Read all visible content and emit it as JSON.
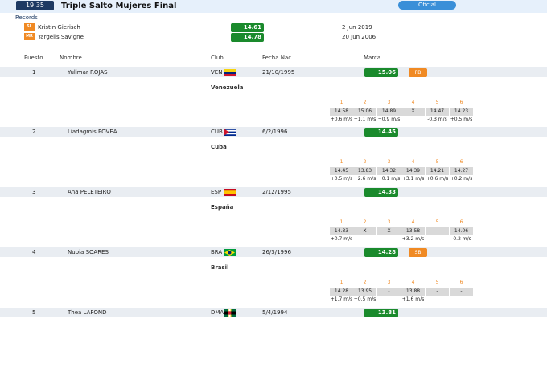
{
  "header": {
    "time": "19:35",
    "title": "Triple Salto Mujeres Final",
    "status": "Oficial"
  },
  "records": {
    "label": "Records",
    "items": [
      {
        "badge": "SL",
        "name": "Kristin Gierisch",
        "mark": "14.61",
        "date": "2 Jun 2019"
      },
      {
        "badge": "MR",
        "name": "Yargelis Savigne",
        "mark": "14.78",
        "date": "20 Jun 2006"
      }
    ]
  },
  "columns": {
    "pos": "Puesto",
    "name": "Nombre",
    "club": "Club",
    "dob": "Fecha Nac.",
    "mark": "Marca"
  },
  "athletes": [
    {
      "pos": "1",
      "name": "Yulimar ROJAS",
      "code": "VEN",
      "dob": "21/10/1995",
      "mark": "15.06",
      "badge": "PB",
      "country": "Venezuela",
      "attempts": [
        {
          "n": "1",
          "v": "14.58",
          "w": "+0.6 m/s"
        },
        {
          "n": "2",
          "v": "15.06",
          "w": "+1.1 m/s"
        },
        {
          "n": "3",
          "v": "14.89",
          "w": "+0.9 m/s"
        },
        {
          "n": "4",
          "v": "X",
          "w": ""
        },
        {
          "n": "5",
          "v": "14.47",
          "w": "-0.3 m/s"
        },
        {
          "n": "6",
          "v": "14.23",
          "w": "+0.5 m/s"
        }
      ]
    },
    {
      "pos": "2",
      "name": "Liadagmis POVEA",
      "code": "CUB",
      "dob": "6/2/1996",
      "mark": "14.45",
      "badge": "",
      "country": "Cuba",
      "attempts": [
        {
          "n": "1",
          "v": "14.45",
          "w": "+0.5 m/s"
        },
        {
          "n": "2",
          "v": "13.83",
          "w": "+2.6 m/s"
        },
        {
          "n": "3",
          "v": "14.32",
          "w": "+0.1 m/s"
        },
        {
          "n": "4",
          "v": "14.39",
          "w": "+3.1 m/s"
        },
        {
          "n": "5",
          "v": "14.21",
          "w": "+0.6 m/s"
        },
        {
          "n": "6",
          "v": "14.27",
          "w": "+0.2 m/s"
        }
      ]
    },
    {
      "pos": "3",
      "name": "Ana PELETEIRO",
      "code": "ESP",
      "dob": "2/12/1995",
      "mark": "14.33",
      "badge": "",
      "country": "España",
      "attempts": [
        {
          "n": "1",
          "v": "14.33",
          "w": "+0.7 m/s"
        },
        {
          "n": "2",
          "v": "X",
          "w": ""
        },
        {
          "n": "3",
          "v": "X",
          "w": ""
        },
        {
          "n": "4",
          "v": "13.58",
          "w": "+3.2 m/s"
        },
        {
          "n": "5",
          "v": "-",
          "w": ""
        },
        {
          "n": "6",
          "v": "14.06",
          "w": "-0.2 m/s"
        }
      ]
    },
    {
      "pos": "4",
      "name": "Nubia SOARES",
      "code": "BRA",
      "dob": "26/3/1996",
      "mark": "14.28",
      "badge": "SB",
      "country": "Brasil",
      "attempts": [
        {
          "n": "1",
          "v": "14.28",
          "w": "+1.7 m/s"
        },
        {
          "n": "2",
          "v": "13.95",
          "w": "+0.5 m/s"
        },
        {
          "n": "3",
          "v": "-",
          "w": ""
        },
        {
          "n": "4",
          "v": "13.88",
          "w": "+1.6 m/s"
        },
        {
          "n": "5",
          "v": "-",
          "w": ""
        },
        {
          "n": "6",
          "v": "-",
          "w": ""
        }
      ]
    },
    {
      "pos": "5",
      "name": "Thea LAFOND",
      "code": "DMA",
      "dob": "5/4/1994",
      "mark": "13.81",
      "badge": "",
      "country": "",
      "attempts": []
    }
  ]
}
